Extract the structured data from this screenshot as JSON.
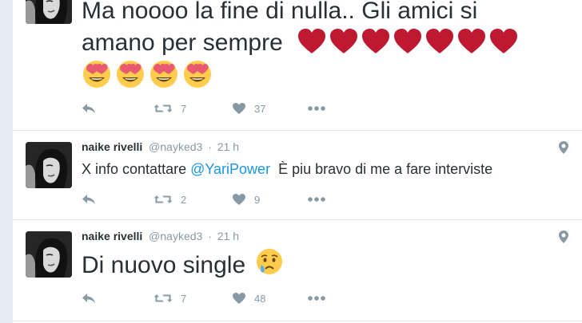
{
  "tweets": [
    {
      "line1": "Ma noooo la fine di nulla.. Gli amici si",
      "line2": "amano per sempre",
      "hearts": 7,
      "faces": 4,
      "reply_icon": "reply-icon",
      "retweet_count": "7",
      "like_count": "37",
      "more_icon": "more-icon"
    },
    {
      "author_name": "naike rivelli",
      "handle": "@nayked3",
      "time": "21 h",
      "text_before": "X info contattare ",
      "mention": "@YariPower",
      "text_after": "  È piu bravo di me a fare interviste",
      "retweet_count": "2",
      "like_count": "9"
    },
    {
      "author_name": "naike rivelli",
      "handle": "@nayked3",
      "time": "21 h",
      "text": "Di nuovo single",
      "retweet_count": "7",
      "like_count": "48"
    }
  ],
  "colors": {
    "text": "#292f33",
    "muted": "#8899a6",
    "link": "#1b95e0",
    "heart_red": "#be1931",
    "divider": "#e1e8ed"
  },
  "icons": [
    "reply-icon",
    "retweet-icon",
    "like-icon",
    "more-icon",
    "geo-pin-icon",
    "red-heart-emoji",
    "heart-eyes-emoji",
    "crying-face-emoji"
  ]
}
